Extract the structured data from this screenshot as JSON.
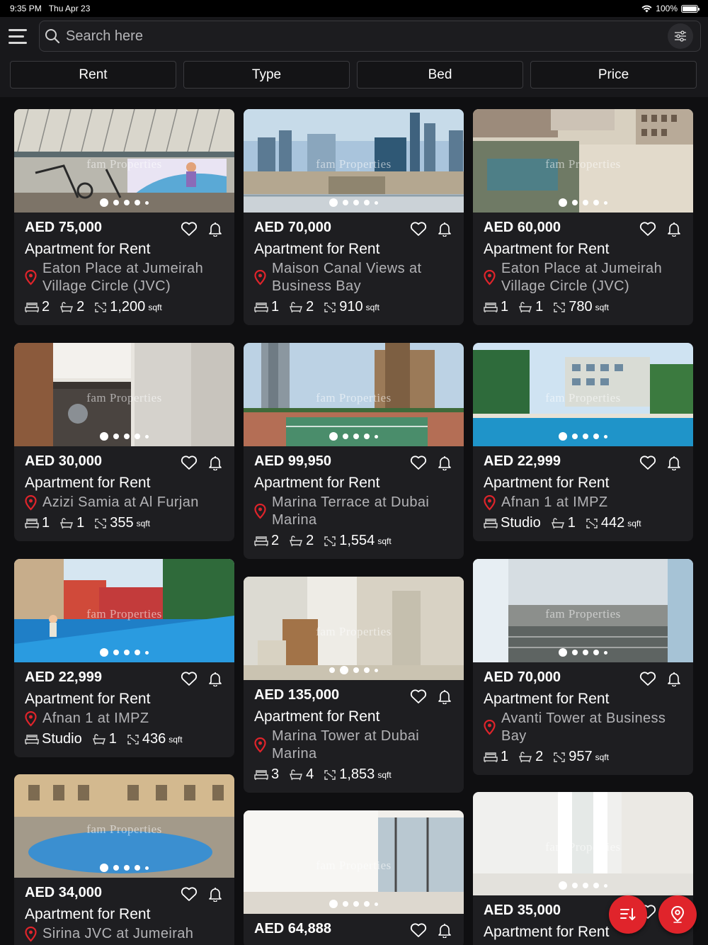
{
  "status": {
    "time": "9:35 PM",
    "date": "Thu Apr 23",
    "battery": "100%",
    "battery_level": 1.0
  },
  "search": {
    "placeholder": "Search here"
  },
  "filters": [
    "Rent",
    "Type",
    "Bed",
    "Price"
  ],
  "watermark": "fam Properties",
  "colors": {
    "accent": "#e0242b",
    "card": "#1e1e21",
    "background": "#0f0f11"
  },
  "listings": [
    {
      "price": "AED 75,000",
      "type": "Apartment for Rent",
      "location": "Eaton Place at Jumeirah Village Circle (JVC)",
      "beds": "2",
      "baths": "2",
      "area": "1,200",
      "unit": "sqft",
      "scene": "gym"
    },
    {
      "price": "AED 70,000",
      "type": "Apartment for Rent",
      "location": "Maison Canal Views at Business Bay",
      "beds": "1",
      "baths": "2",
      "area": "910",
      "unit": "sqft",
      "scene": "city"
    },
    {
      "price": "AED 60,000",
      "type": "Apartment for Rent",
      "location": "Eaton Place at Jumeirah Village Circle (JVC)",
      "beds": "1",
      "baths": "1",
      "area": "780",
      "unit": "sqft",
      "scene": "aerial"
    },
    {
      "price": "AED 30,000",
      "type": "Apartment for Rent",
      "location": "Azizi Samia at Al Furjan",
      "beds": "1",
      "baths": "1",
      "area": "355",
      "unit": "sqft",
      "scene": "kitchen"
    },
    {
      "price": "AED 99,950",
      "type": "Apartment for Rent",
      "location": "Marina Terrace at Dubai Marina",
      "beds": "2",
      "baths": "2",
      "area": "1,554",
      "unit": "sqft",
      "scene": "tennis"
    },
    {
      "price": "AED 22,999",
      "type": "Apartment for Rent",
      "location": "Afnan 1 at IMPZ",
      "beds": "Studio",
      "baths": "1",
      "area": "442",
      "unit": "sqft",
      "scene": "pool"
    },
    {
      "price": "AED 22,999",
      "type": "Apartment for Rent",
      "location": "Afnan 1 at IMPZ",
      "beds": "Studio",
      "baths": "1",
      "area": "436",
      "unit": "sqft",
      "scene": "garden"
    },
    {
      "price": "AED 135,000",
      "type": "Apartment for Rent",
      "location": "Marina Tower at Dubai Marina",
      "beds": "3",
      "baths": "4",
      "area": "1,853",
      "unit": "sqft",
      "scene": "room"
    },
    {
      "price": "AED 70,000",
      "type": "Apartment for Rent",
      "location": "Avanti Tower at Business Bay",
      "beds": "1",
      "baths": "2",
      "area": "957",
      "unit": "sqft",
      "scene": "highway"
    },
    {
      "price": "AED 34,000",
      "type": "Apartment for Rent",
      "location": "Sirina JVC at Jumeirah",
      "beds": "",
      "baths": "",
      "area": "",
      "unit": "",
      "scene": "pool2"
    },
    {
      "price": "AED 64,888",
      "type": "",
      "location": "",
      "beds": "",
      "baths": "",
      "area": "",
      "unit": "",
      "scene": "empty"
    },
    {
      "price": "AED 35,000",
      "type": "Apartment for Rent",
      "location": "",
      "beds": "",
      "baths": "",
      "area": "",
      "unit": "",
      "scene": "bright"
    }
  ],
  "fabs": {
    "sort": "sort-icon",
    "map": "map-pin-icon"
  }
}
